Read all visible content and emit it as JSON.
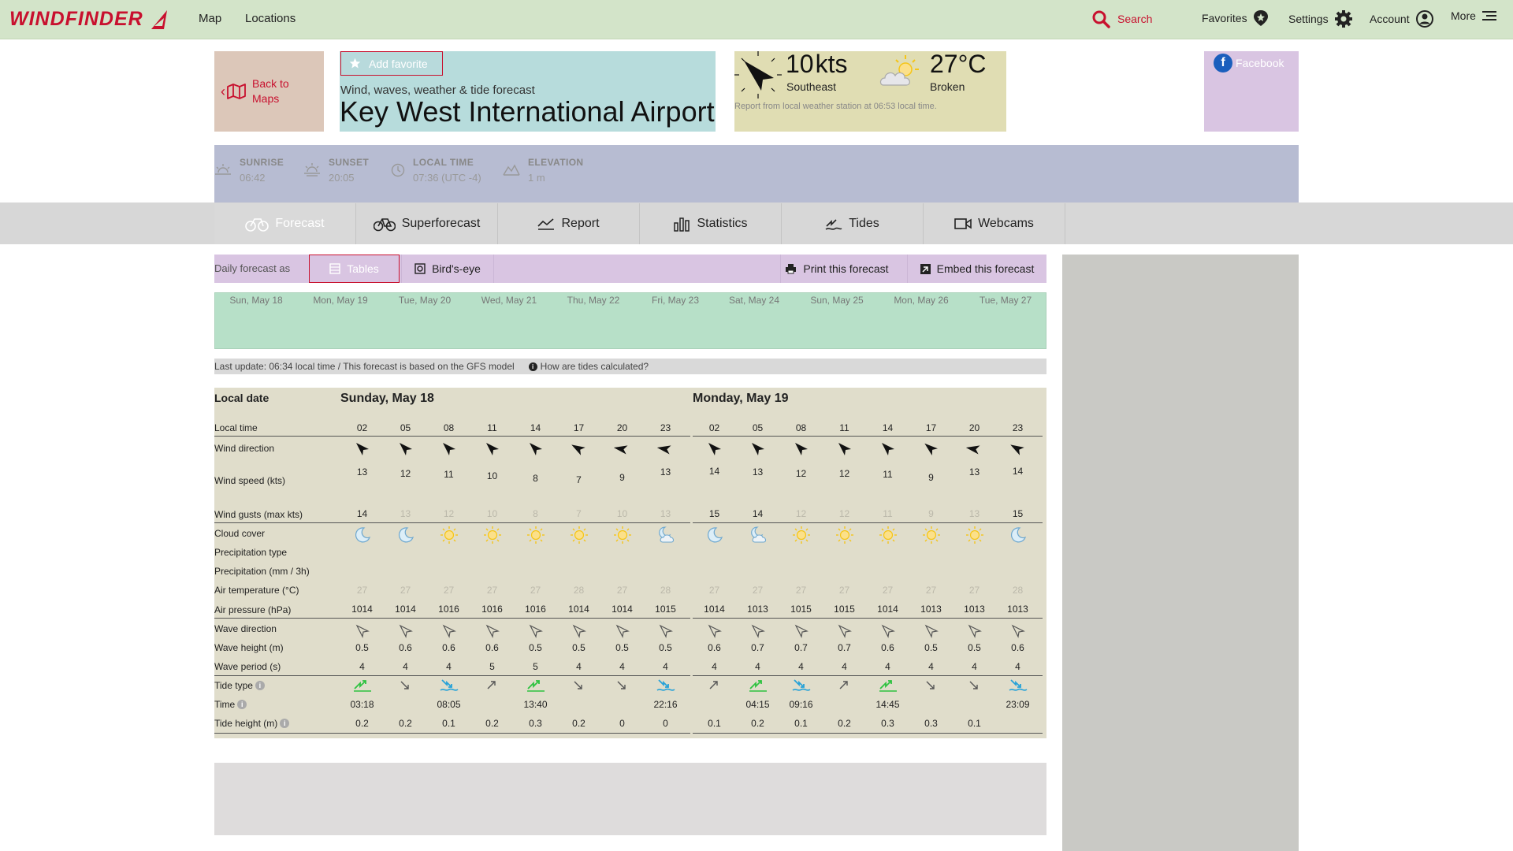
{
  "brand": {
    "name": "WINDFINDER",
    "color": "#c8102e"
  },
  "nav": {
    "map": "Map",
    "locations": "Locations"
  },
  "top_right": {
    "search": "Search",
    "favorites": "Favorites",
    "settings": "Settings",
    "account": "Account",
    "more": "More"
  },
  "header": {
    "back": "Back to Maps",
    "add_favorite": "Add favorite",
    "subtitle": "Wind, waves, weather & tide forecast",
    "title": "Key West International Airport"
  },
  "current": {
    "wind_speed": "10",
    "wind_unit": "kts",
    "wind_direction": "Southeast",
    "temperature": "27",
    "temp_unit": "°C",
    "condition": "Broken",
    "report_note": "Report from local weather station at 06:53 local time."
  },
  "social": {
    "facebook": "Facebook"
  },
  "info": {
    "sunrise_label": "SUNRISE",
    "sunrise": "06:42",
    "sunset_label": "SUNSET",
    "sunset": "20:05",
    "localtime_label": "LOCAL TIME",
    "localtime": "07:36 (UTC -4)",
    "elevation_label": "ELEVATION",
    "elevation": "1 m"
  },
  "tabs": [
    "Forecast",
    "Superforecast",
    "Report",
    "Statistics",
    "Tides",
    "Webcams"
  ],
  "toolbar": {
    "label": "Daily forecast as",
    "tables": "Tables",
    "birds_eye": "Bird's-eye",
    "print": "Print this forecast",
    "embed": "Embed this forecast"
  },
  "days": [
    "Sun, May 18",
    "Mon, May 19",
    "Tue, May 20",
    "Wed, May 21",
    "Thu, May 22",
    "Fri, May 23",
    "Sat, May 24",
    "Sun, May 25",
    "Mon, May 26",
    "Tue, May 27"
  ],
  "update": {
    "text": "Last update: 06:34 local time / This forecast is based on the GFS model",
    "tides_link": "How are tides calculated?"
  },
  "forecast": {
    "labels": {
      "local_date": "Local date",
      "local_time": "Local time",
      "wind_direction": "Wind direction",
      "wind_speed": "Wind speed (kts)",
      "wind_gusts": "Wind gusts (max kts)",
      "cloud_cover": "Cloud cover",
      "precip_type": "Precipitation type",
      "precip": "Precipitation (mm / 3h)",
      "air_temp": "Air temperature (°C)",
      "air_pressure": "Air pressure (hPa)",
      "wave_direction": "Wave direction",
      "wave_height": "Wave height (m)",
      "wave_period": "Wave period (s)",
      "tide_type": "Tide type",
      "tide_time": "Time",
      "tide_height": "Tide height (m)"
    },
    "days": [
      {
        "title": "Sunday, May 18",
        "times": [
          "02",
          "05",
          "08",
          "11",
          "14",
          "17",
          "20",
          "23"
        ],
        "wind_dir": [
          135,
          135,
          135,
          135,
          135,
          120,
          100,
          100
        ],
        "wind_speed": [
          "13",
          "12",
          "11",
          "10",
          "8",
          "7",
          "9",
          "13"
        ],
        "wind_gusts": [
          "14",
          "13",
          "12",
          "10",
          "8",
          "7",
          "10",
          "13"
        ],
        "cloud": [
          "moon",
          "moon",
          "sun",
          "sun",
          "sun",
          "sun",
          "sun",
          "moon-cloud"
        ],
        "air_temp": [
          "27",
          "27",
          "27",
          "27",
          "27",
          "28",
          "27",
          "28"
        ],
        "air_pressure": [
          "1014",
          "1014",
          "1016",
          "1016",
          "1016",
          "1014",
          "1014",
          "1015"
        ],
        "wave_height": [
          "0.5",
          "0.6",
          "0.6",
          "0.6",
          "0.5",
          "0.5",
          "0.5",
          "0.5"
        ],
        "wave_period": [
          "4",
          "4",
          "4",
          "5",
          "5",
          "4",
          "4",
          "4"
        ],
        "tide_type": [
          "high-rising",
          "falling",
          "low",
          "rising",
          "high-rising",
          "falling",
          "falling",
          "low"
        ],
        "tide_time": [
          "03:18",
          "",
          "08:05",
          "",
          "13:40",
          "",
          "",
          "22:16"
        ],
        "tide_height": [
          "0.2",
          "0.2",
          "0.1",
          "0.2",
          "0.3",
          "0.2",
          "0",
          "0"
        ]
      },
      {
        "title": "Monday, May 19",
        "times": [
          "02",
          "05",
          "08",
          "11",
          "14",
          "17",
          "20",
          "23"
        ],
        "wind_dir": [
          135,
          135,
          135,
          135,
          135,
          130,
          100,
          120
        ],
        "wind_speed": [
          "14",
          "13",
          "12",
          "12",
          "11",
          "9",
          "13",
          "14"
        ],
        "wind_gusts": [
          "15",
          "14",
          "12",
          "12",
          "11",
          "9",
          "13",
          "15"
        ],
        "cloud": [
          "moon",
          "moon-cloud",
          "sun",
          "sun",
          "sun",
          "sun",
          "sun",
          "moon"
        ],
        "air_temp": [
          "27",
          "27",
          "27",
          "27",
          "27",
          "27",
          "27",
          "28"
        ],
        "air_pressure": [
          "1014",
          "1013",
          "1015",
          "1015",
          "1014",
          "1013",
          "1013",
          "1013"
        ],
        "wave_height": [
          "0.6",
          "0.7",
          "0.7",
          "0.7",
          "0.6",
          "0.5",
          "0.5",
          "0.6"
        ],
        "wave_period": [
          "4",
          "4",
          "4",
          "4",
          "4",
          "4",
          "4",
          "4"
        ],
        "tide_type": [
          "rising",
          "high-rising",
          "low",
          "rising",
          "high-rising",
          "falling",
          "falling",
          "low"
        ],
        "tide_time": [
          "",
          "04:15",
          "09:16",
          "",
          "14:45",
          "",
          "",
          "23:09"
        ],
        "tide_height": [
          "0.1",
          "0.2",
          "0.1",
          "0.2",
          "0.3",
          "0.3",
          "0.1",
          ""
        ]
      }
    ]
  },
  "colors": {
    "topbar": "#d3e4c9",
    "accent": "#c8102e",
    "tide_green": "#2ec240",
    "tide_blue": "#27a2d8"
  }
}
